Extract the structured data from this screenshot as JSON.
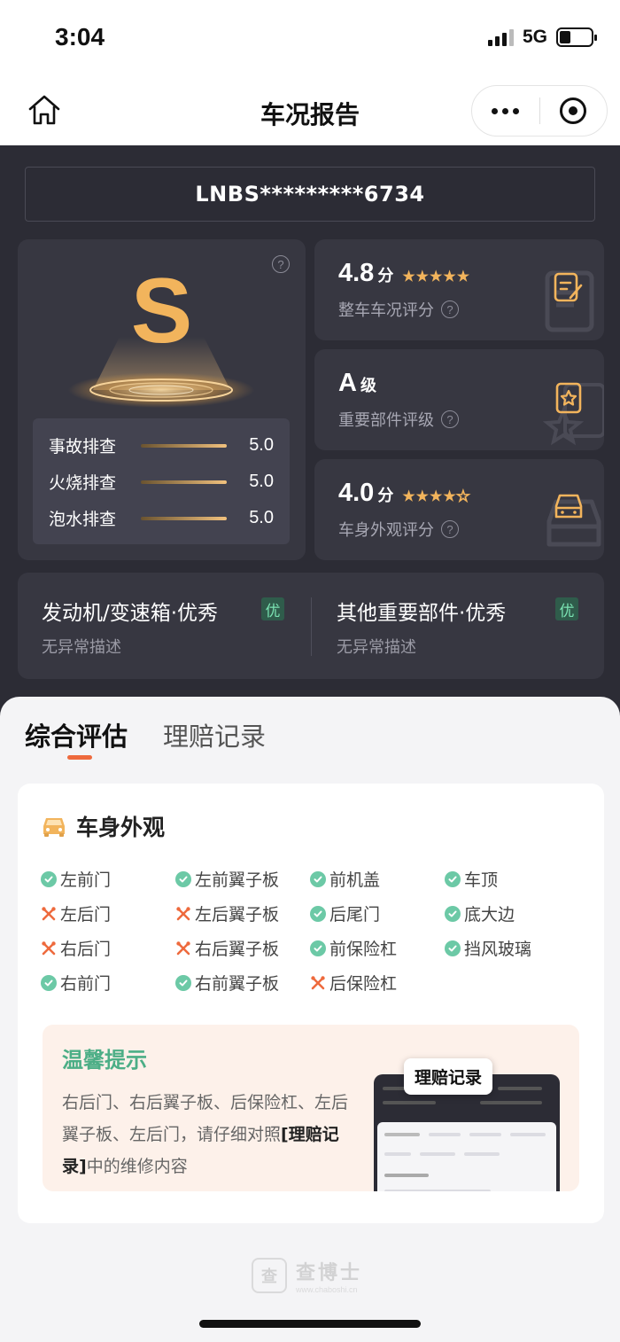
{
  "status_bar": {
    "time": "3:04",
    "network": "5G"
  },
  "nav": {
    "title": "车况报告"
  },
  "vin": "LNBS*********6734",
  "grade": {
    "letter": "S",
    "checks": [
      {
        "label": "事故排查",
        "value": "5.0"
      },
      {
        "label": "火烧排查",
        "value": "5.0"
      },
      {
        "label": "泡水排查",
        "value": "5.0"
      }
    ]
  },
  "scores": [
    {
      "value": "4.8",
      "unit": "分",
      "stars": 5,
      "label": "整车车况评分",
      "icon": "document-edit-icon"
    },
    {
      "value": "A",
      "unit": "级",
      "stars": 0,
      "label": "重要部件评级",
      "icon": "star-document-icon"
    },
    {
      "value": "4.0",
      "unit": "分",
      "stars": 4,
      "label": "车身外观评分",
      "icon": "car-front-icon"
    }
  ],
  "parts": [
    {
      "title": "发动机/变速箱·优秀",
      "badge": "优",
      "desc": "无异常描述"
    },
    {
      "title": "其他重要部件·优秀",
      "badge": "优",
      "desc": "无异常描述"
    }
  ],
  "tabs": [
    {
      "label": "综合评估",
      "active": true
    },
    {
      "label": "理赔记录",
      "active": false
    }
  ],
  "appearance": {
    "title": "车身外观",
    "items": [
      {
        "label": "左前门",
        "status": "ok"
      },
      {
        "label": "左前翼子板",
        "status": "ok"
      },
      {
        "label": "前机盖",
        "status": "ok"
      },
      {
        "label": "车顶",
        "status": "ok"
      },
      {
        "label": "左后门",
        "status": "repaired"
      },
      {
        "label": "左后翼子板",
        "status": "repaired"
      },
      {
        "label": "后尾门",
        "status": "ok"
      },
      {
        "label": "底大边",
        "status": "ok"
      },
      {
        "label": "右后门",
        "status": "repaired"
      },
      {
        "label": "右后翼子板",
        "status": "repaired"
      },
      {
        "label": "前保险杠",
        "status": "ok"
      },
      {
        "label": "挡风玻璃",
        "status": "ok"
      },
      {
        "label": "右前门",
        "status": "ok"
      },
      {
        "label": "右前翼子板",
        "status": "ok"
      },
      {
        "label": "后保险杠",
        "status": "repaired"
      }
    ]
  },
  "tip": {
    "title": "温馨提示",
    "text_before": "右后门、右后翼子板、后保险杠、左后翼子板、左后门，请仔细对照",
    "text_link": "[理赔记录]",
    "text_after": "中的维修内容",
    "callout": "理赔记录"
  },
  "footer": {
    "brand": "查博士",
    "url": "www.chaboshi.cn"
  },
  "colors": {
    "accent": "#f2b45c",
    "ok": "#6cc9a6",
    "repair": "#ee6a3d",
    "dark_bg": "#2c2c35"
  }
}
